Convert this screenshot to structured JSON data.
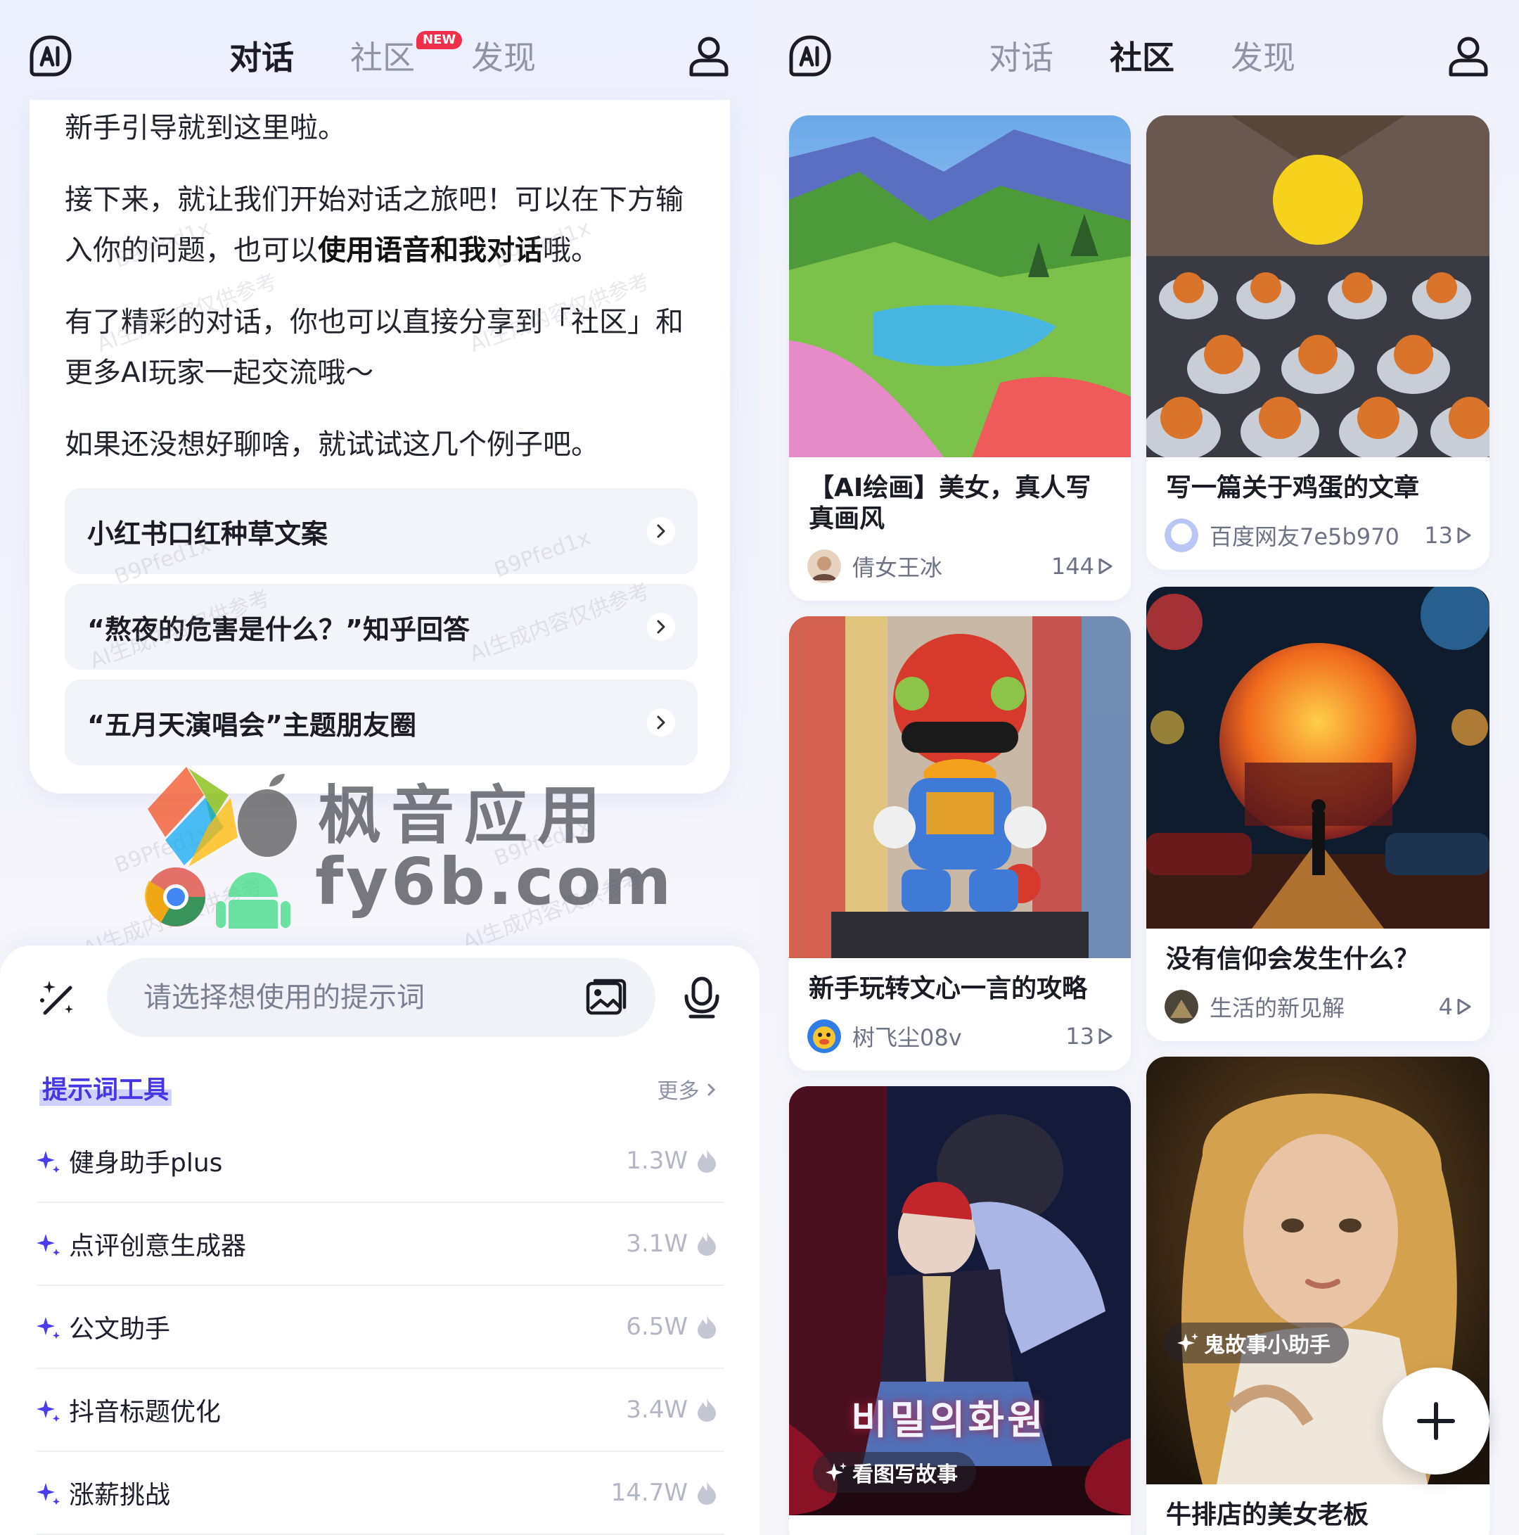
{
  "left_screen": {
    "tabs": [
      {
        "label": "对话",
        "active": true
      },
      {
        "label": "社区",
        "active": false,
        "badge": "NEW"
      },
      {
        "label": "发现",
        "active": false
      }
    ],
    "chat": {
      "p1": "新手引导就到这里啦。",
      "p2_start": "接下来，就让我们开始对话之旅吧！可以在下方输入你的问题，也可以",
      "p2_bold": "使用语音和我对话",
      "p2_end": "哦。",
      "p3": "有了精彩的对话，你也可以直接分享到「社区」和更多AI玩家一起交流哦～",
      "p4": "如果还没想好聊啥，就试试这几个例子吧。",
      "suggestions": [
        "小红书口红种草文案",
        "“熬夜的危害是什么？”知乎回答",
        "“五月天演唱会”主题朋友圈"
      ]
    },
    "watermark": {
      "code": "B9Pfed1x",
      "note": "AI生成内容仅供参考",
      "brand_cn": "枫音应用",
      "brand_url": "fy6b.com"
    },
    "input": {
      "placeholder": "请选择想使用的提示词"
    },
    "prompt_tools": {
      "title": "提示词工具",
      "more": "更多",
      "items": [
        {
          "name": "健身助手plus",
          "count": "1.3W"
        },
        {
          "name": "点评创意生成器",
          "count": "3.1W"
        },
        {
          "name": "公文助手",
          "count": "6.5W"
        },
        {
          "name": "抖音标题优化",
          "count": "3.4W"
        },
        {
          "name": "涨薪挑战",
          "count": "14.7W"
        }
      ]
    }
  },
  "right_screen": {
    "tabs": [
      {
        "label": "对话",
        "active": false
      },
      {
        "label": "社区",
        "active": true
      },
      {
        "label": "发现",
        "active": false
      }
    ],
    "posts": [
      {
        "title": "【AI绘画】美女，真人写真画风",
        "author": "倩女王冰",
        "likes": "144"
      },
      {
        "title": "写一篇关于鸡蛋的文章",
        "author": "百度网友7e5b970",
        "likes": "13"
      },
      {
        "title": "新手玩转文心一言的攻略",
        "author": "树飞尘08v",
        "likes": "13"
      },
      {
        "title": "没有信仰会发生什么？",
        "author": "生活的新见解",
        "likes": "4"
      },
      {
        "title": "",
        "author": "",
        "likes": "",
        "chip": "看图写故事",
        "overlay": "비밀의화원"
      },
      {
        "title": "牛排店的美女老板",
        "author": "",
        "likes": "",
        "chip": "鬼故事小助手"
      }
    ]
  },
  "colors": {
    "accent": "#4636e6",
    "badge": "#f0304a",
    "text": "#1b1b26",
    "muted": "#8e93a6"
  }
}
